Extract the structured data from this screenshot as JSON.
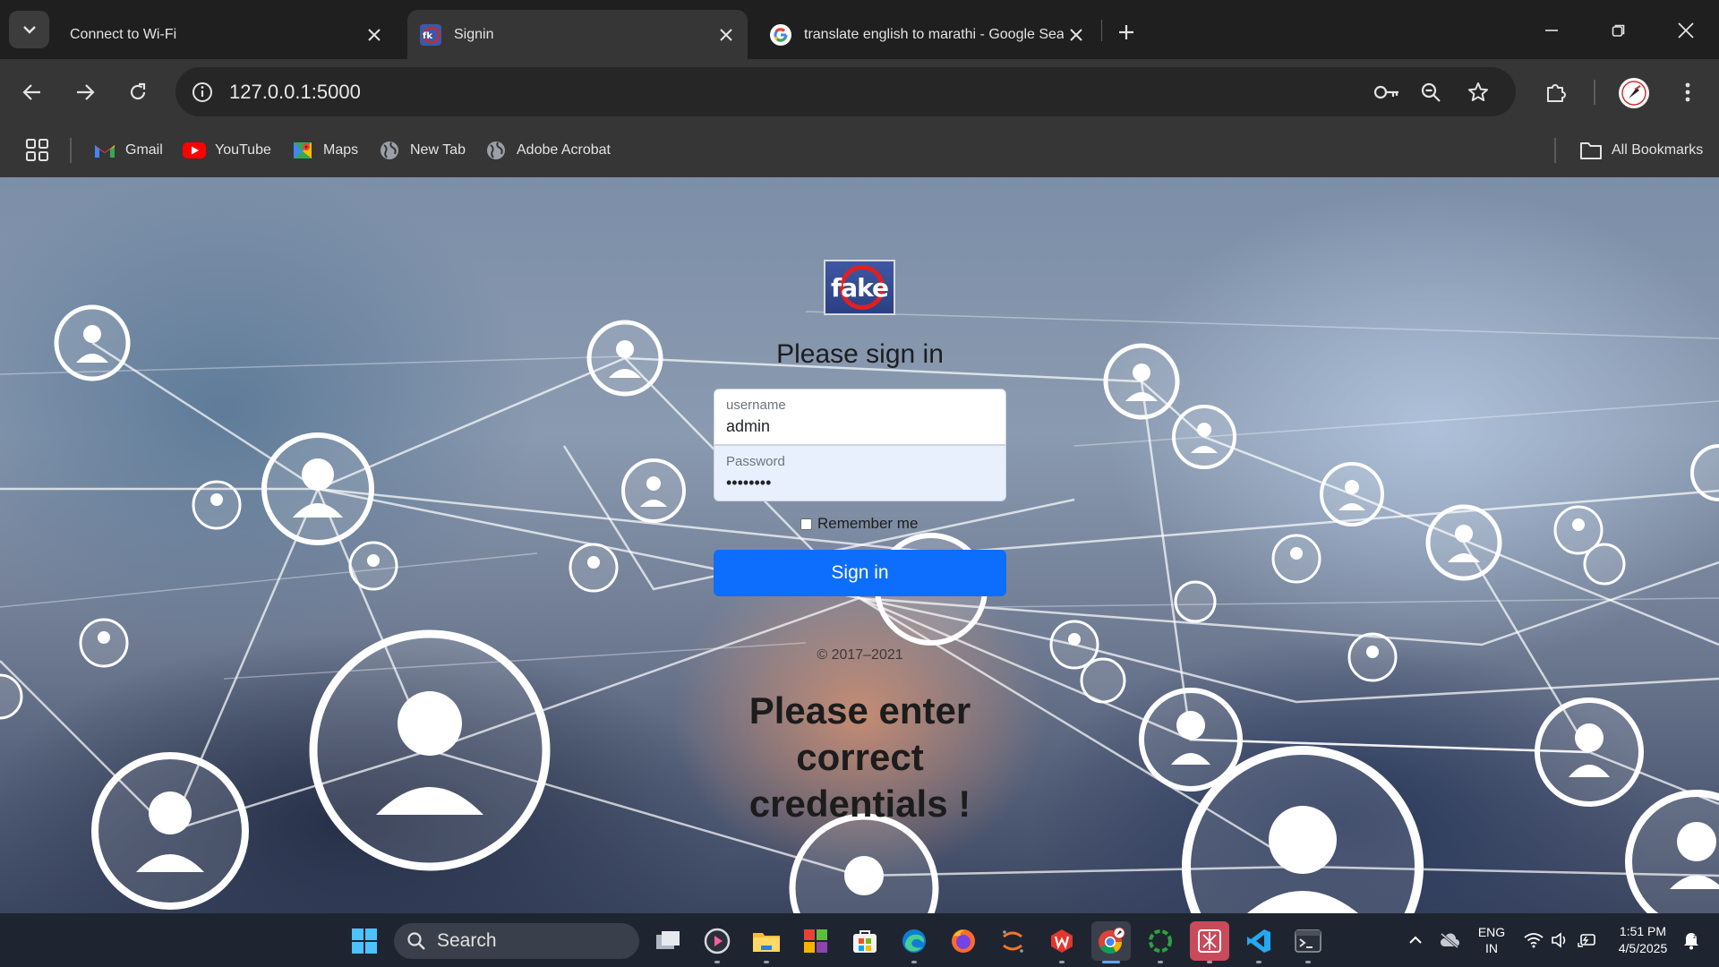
{
  "tabs": [
    {
      "title": "Connect to Wi-Fi",
      "favicon": "none"
    },
    {
      "title": "Signin",
      "favicon": "fake-logo-icon"
    },
    {
      "title": "translate english to marathi - Google Search",
      "favicon": "google-icon"
    }
  ],
  "address_bar": {
    "url": "127.0.0.1:5000"
  },
  "bookmarks": [
    {
      "label": "Gmail",
      "icon": "gmail-icon"
    },
    {
      "label": "YouTube",
      "icon": "youtube-icon"
    },
    {
      "label": "Maps",
      "icon": "maps-icon"
    },
    {
      "label": "New Tab",
      "icon": "globe-icon"
    },
    {
      "label": "Adobe Acrobat",
      "icon": "globe-icon"
    }
  ],
  "all_bookmarks_label": "All Bookmarks",
  "signin": {
    "logo_text": "fake",
    "heading": "Please sign in",
    "username_label": "username",
    "username_value": "admin",
    "password_label": "Password",
    "password_masked": "••••••••",
    "remember_label": "Remember me",
    "remember_checked": false,
    "button_label": "Sign in",
    "copyright": "© 2017–2021",
    "error_message": "Please enter correct credentials !"
  },
  "taskbar": {
    "search_label": "Search",
    "language": {
      "line1": "ENG",
      "line2": "IN"
    },
    "time": "1:51 PM",
    "date": "4/5/2025",
    "apps": [
      "task-view-icon",
      "media-player-icon",
      "file-explorer-icon",
      "color-tiles-icon",
      "store-icon",
      "edge-icon",
      "firefox-icon",
      "jupyter-icon",
      "wps-office-icon",
      "chrome-icon",
      "spinner-app-icon",
      "cursor-app-icon",
      "vscode-icon",
      "terminal-icon"
    ]
  },
  "colors": {
    "primary_button": "#0d6efd",
    "tab_strip": "#1f1f1f",
    "toolbar": "#363636"
  }
}
